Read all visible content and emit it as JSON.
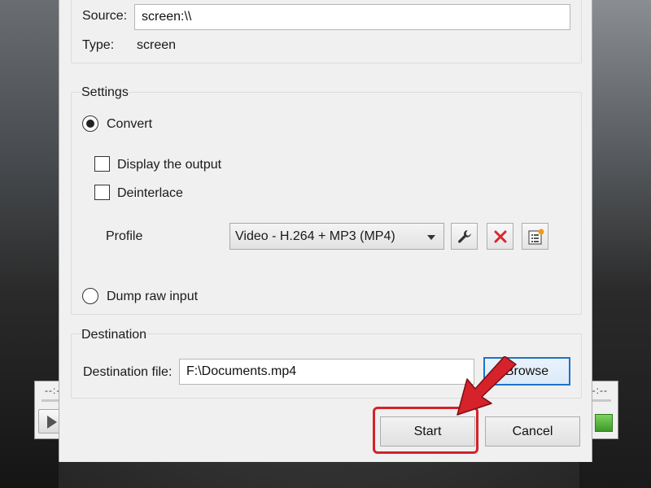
{
  "source": {
    "source_label": "Source:",
    "source_value": "screen:\\\\",
    "type_label": "Type:",
    "type_value": "screen"
  },
  "settings": {
    "title": "Settings",
    "convert_label": "Convert",
    "convert_selected": true,
    "display_output_label": "Display the output",
    "display_output_checked": false,
    "deinterlace_label": "Deinterlace",
    "deinterlace_checked": false,
    "profile_label": "Profile",
    "profile_selected": "Video - H.264 + MP3 (MP4)",
    "dump_raw_label": "Dump raw input",
    "dump_raw_selected": false
  },
  "destination": {
    "title": "Destination",
    "file_label": "Destination file:",
    "file_value": "F:\\Documents.mp4",
    "browse_label": "Browse"
  },
  "actions": {
    "start_label": "Start",
    "cancel_label": "Cancel"
  },
  "player": {
    "time_left": "--:--",
    "time_right": "--:--"
  },
  "colors": {
    "highlight": "#d6222a",
    "focus": "#1e73c8",
    "dialog_bg": "#f0f0f0"
  },
  "icons": [
    "wrench-icon",
    "delete-x-icon",
    "new-profile-icon",
    "play-icon",
    "red-pointer-arrow"
  ]
}
